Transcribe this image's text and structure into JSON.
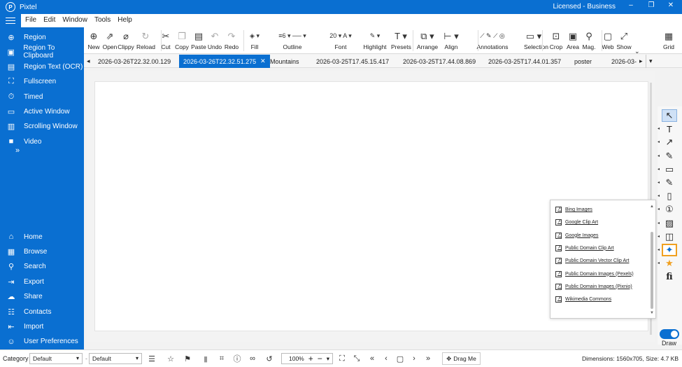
{
  "app": {
    "title": "Pixtel",
    "license": "Licensed - Business",
    "logo_glyph": "P",
    "win_min": "–",
    "win_restore": "❐",
    "win_close": "✕"
  },
  "menu": [
    "File",
    "Edit",
    "Window",
    "Tools",
    "Help"
  ],
  "sidebar": {
    "capture_items": [
      {
        "label": "Region",
        "icon": "region-icon",
        "glyph": "⊕"
      },
      {
        "label": "Region To Clipboard",
        "icon": "clipboard-icon",
        "glyph": "▣"
      },
      {
        "label": "Region Text (OCR)",
        "icon": "ocr-icon",
        "glyph": "▤"
      },
      {
        "label": "Fullscreen",
        "icon": "fullscreen-icon",
        "glyph": "⛶"
      },
      {
        "label": "Timed",
        "icon": "timer-icon",
        "glyph": "⏱"
      },
      {
        "label": "Active Window",
        "icon": "window-icon",
        "glyph": "▭"
      },
      {
        "label": "Scrolling Window",
        "icon": "scrolling-window-icon",
        "glyph": "▥"
      },
      {
        "label": "Video",
        "icon": "video-icon",
        "glyph": "■"
      }
    ],
    "more_glyph": "»",
    "nav_items": [
      {
        "label": "Home",
        "icon": "home-icon",
        "glyph": "⌂"
      },
      {
        "label": "Browse",
        "icon": "browse-icon",
        "glyph": "▦"
      },
      {
        "label": "Search",
        "icon": "search-icon",
        "glyph": "⚲"
      },
      {
        "label": "Export",
        "icon": "export-icon",
        "glyph": "⇥"
      },
      {
        "label": "Share",
        "icon": "share-icon",
        "glyph": "☁"
      },
      {
        "label": "Contacts",
        "icon": "contacts-icon",
        "glyph": "☷"
      },
      {
        "label": "Import",
        "icon": "import-icon",
        "glyph": "⇤"
      },
      {
        "label": "User Preferences",
        "icon": "user-icon",
        "glyph": "☺"
      }
    ]
  },
  "toolbar": {
    "buttons": [
      {
        "label": "New",
        "icon": "new-icon",
        "glyph": "⊕"
      },
      {
        "label": "Open",
        "icon": "open-icon",
        "glyph": "⇗"
      },
      {
        "label": "Clippy",
        "icon": "clippy-icon",
        "glyph": "⌀"
      },
      {
        "label": "Reload",
        "icon": "reload-icon",
        "glyph": "↻"
      },
      {
        "label": "Cut",
        "icon": "cut-icon",
        "glyph": "✂"
      },
      {
        "label": "Copy",
        "icon": "copy-icon",
        "glyph": "❐"
      },
      {
        "label": "Paste",
        "icon": "paste-icon",
        "glyph": "▤"
      },
      {
        "label": "Undo",
        "icon": "undo-icon",
        "glyph": "↶"
      },
      {
        "label": "Redo",
        "icon": "redo-icon",
        "glyph": "↷"
      },
      {
        "label": "Fill",
        "icon": "fill-icon",
        "glyph": "◈ ▾"
      },
      {
        "label": "Outline",
        "icon": "outline-icon",
        "glyph": "≡6 ▾  ── ▾"
      },
      {
        "label": "Font",
        "icon": "font-icon",
        "glyph": "20 ▾  A ▾"
      },
      {
        "label": "Highlight",
        "icon": "highlight-icon",
        "glyph": "✎ ▾"
      },
      {
        "label": "Presets",
        "icon": "presets-icon",
        "glyph": "T ▾"
      },
      {
        "label": "Arrange",
        "icon": "arrange-icon",
        "glyph": "⧉ ▾"
      },
      {
        "label": "Align",
        "icon": "align-icon",
        "glyph": "⊢ ▾"
      },
      {
        "label": "Annotations",
        "icon": "annotations-icon",
        "glyph": "⟋ ✎ ⟋ ◎"
      },
      {
        "label": "Selection",
        "icon": "selection-icon",
        "glyph": "▭ ▾"
      },
      {
        "label": "Crop",
        "icon": "crop-icon",
        "glyph": "⊡"
      },
      {
        "label": "Area",
        "icon": "area-icon",
        "glyph": "▣"
      },
      {
        "label": "Mag.",
        "icon": "magnify-icon",
        "glyph": "⚲"
      },
      {
        "label": "Web",
        "icon": "web-icon",
        "glyph": "▢"
      },
      {
        "label": "Show",
        "icon": "show-icon",
        "glyph": "⤢"
      },
      {
        "label": "Grid",
        "icon": "grid-icon",
        "glyph": "▦"
      }
    ],
    "expand_glyph": "⌄"
  },
  "tabs": {
    "scroll_left": "◂",
    "items": [
      {
        "label": "2026-03-26T22.32.00.129"
      },
      {
        "label": "2026-03-26T22.32.51.275",
        "active": true
      },
      {
        "label": "Mountains"
      },
      {
        "label": "2026-03-25T17.45.15.417"
      },
      {
        "label": "2026-03-25T17.44.08.869"
      },
      {
        "label": "2026-03-25T17.44.01.357"
      },
      {
        "label": "poster"
      },
      {
        "label": "2026-03-"
      }
    ],
    "close_glyph": "✕",
    "scroll_right": "▸",
    "list_glyph": "▾"
  },
  "clipart_popup": {
    "items": [
      "Bing Images",
      "Google Clip Art",
      "Google Images",
      "Public Domain Clip Art",
      "Public Domain Vector Clip Art",
      "Public Domain Images (Pexels)",
      "Public Domain Images (Pixnio)",
      "Wikimedia Commons"
    ],
    "link_glyph": "↗",
    "up_glyph": "▲",
    "down_glyph": "▼"
  },
  "tools": [
    {
      "name": "pointer-tool",
      "glyph": "↖",
      "selected": true
    },
    {
      "name": "text-tool",
      "glyph": "T"
    },
    {
      "name": "arrow-tool",
      "glyph": "↗"
    },
    {
      "name": "pen-tool",
      "glyph": "✎"
    },
    {
      "name": "rectangle-tool",
      "glyph": "▭"
    },
    {
      "name": "highlighter-tool",
      "glyph": "✎"
    },
    {
      "name": "note-tool",
      "glyph": "▯"
    },
    {
      "name": "step-number-tool",
      "glyph": "①"
    },
    {
      "name": "image-tool",
      "glyph": "▨"
    },
    {
      "name": "stamp-tool",
      "glyph": "◫"
    },
    {
      "name": "clipart-tool",
      "glyph": "✦",
      "highlight": true
    },
    {
      "name": "favorite-tool",
      "glyph": "★"
    },
    {
      "name": "fi-tool",
      "glyph": "fi"
    }
  ],
  "draw_toggle": {
    "label": "Draw",
    "on": true
  },
  "status": {
    "category_label": "Category",
    "category_value": "Default",
    "second_value": "Default",
    "caret_glyph": "▾",
    "icons": [
      {
        "name": "notes-icon",
        "glyph": "☰"
      },
      {
        "name": "star-icon",
        "glyph": "☆"
      },
      {
        "name": "flag-icon",
        "glyph": "⚑"
      },
      {
        "name": "bookmark-icon",
        "glyph": "▮"
      },
      {
        "name": "tag-icon",
        "glyph": "⌗"
      },
      {
        "name": "info-icon",
        "glyph": "ⓘ"
      },
      {
        "name": "link-icon",
        "glyph": "∞"
      },
      {
        "name": "history-icon",
        "glyph": "↺"
      }
    ],
    "zoom": "100%",
    "zoom_plus": "+",
    "zoom_minus": "−",
    "zoom_caret": "▾",
    "view_icons": [
      {
        "name": "fit-icon",
        "glyph": "⛶"
      },
      {
        "name": "shrink-icon",
        "glyph": "⤡"
      },
      {
        "name": "first-icon",
        "glyph": "«"
      },
      {
        "name": "prev-icon",
        "glyph": "‹"
      },
      {
        "name": "frame-icon",
        "glyph": "▢"
      },
      {
        "name": "next-icon",
        "glyph": "›"
      },
      {
        "name": "last-icon",
        "glyph": "»"
      }
    ],
    "drag_label": "Drag Me",
    "drag_glyph": "✥",
    "dimensions": "Dimensions: 1560x705, Size: 4.7 KB"
  },
  "colors": {
    "accent": "#0a6fd1",
    "highlight_border": "#f0a020",
    "fill_swatch": "#e07b1a",
    "font_swatch": "#2e8b3a",
    "highlight_swatch": "#c040c0"
  }
}
